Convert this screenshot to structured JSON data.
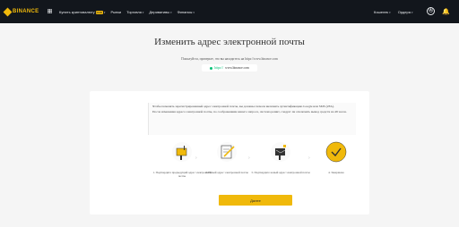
{
  "header": {
    "logo_text": "BINANCE",
    "nav": [
      {
        "label": "Купить криптовалюту",
        "badge": "RUB"
      },
      {
        "label": "Рынки"
      },
      {
        "label": "Торговля"
      },
      {
        "label": "Деривативы"
      },
      {
        "label": "Финансы"
      }
    ],
    "wallet_label": "Кошелек",
    "orders_label": "Ордера",
    "account_glyph": "Ⓐ"
  },
  "page": {
    "title": "Изменить адрес электронной почты",
    "subtitle": "Пожалуйста, проверьте, что вы находитесь на https://www.binance.com",
    "url_prefix": "https://",
    "url_host": "www.binance.com"
  },
  "notice": {
    "line1": "Чтобы поменять зарегистрированный адрес электронной почты, вы должны сначала включить аутентификацию Google или SMS (2FA).",
    "line2": "После изменения адреса электронной почты, по соображениям вашего запроса, система решит, следует ли отключить вывод средств на 48 часов."
  },
  "steps": [
    {
      "label": "1. Подтвердите предыдущий адрес электронной почты",
      "icon": "mailbox-icon"
    },
    {
      "label": "2. Новый адрес электронной почты",
      "icon": "notepad-icon"
    },
    {
      "label": "3. Подтвердите новый адрес электронной почты",
      "icon": "mailbox-icon"
    },
    {
      "label": "4. Завершено",
      "icon": "checkmark-icon"
    }
  ],
  "cta_label": "Далее",
  "colors": {
    "accent": "#f0b90b",
    "topbar": "#12161c",
    "green": "#02c076"
  }
}
